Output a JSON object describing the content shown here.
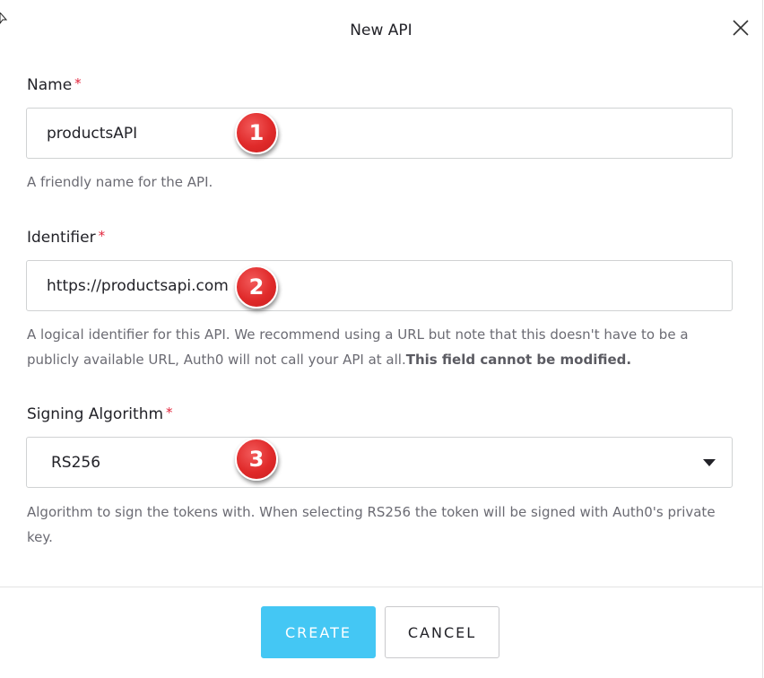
{
  "dialog": {
    "title": "New API",
    "close_icon": "close-icon"
  },
  "form": {
    "name": {
      "label": "Name",
      "required_mark": "*",
      "value": "productsAPI",
      "help": "A friendly name for the API.",
      "badge": "1"
    },
    "identifier": {
      "label": "Identifier",
      "required_mark": "*",
      "value": "https://productsapi.com",
      "help": "A logical identifier for this API. We recommend using a URL but note that this doesn't have to be a publicly available URL, Auth0 will not call your API at all.",
      "help_bold": "This field cannot be modified.",
      "badge": "2"
    },
    "signing_algorithm": {
      "label": "Signing Algorithm",
      "required_mark": "*",
      "selected": "RS256",
      "help": "Algorithm to sign the tokens with. When selecting RS256 the token will be signed with Auth0's private key.",
      "badge": "3"
    }
  },
  "actions": {
    "create_label": "CREATE",
    "cancel_label": "CANCEL"
  },
  "colors": {
    "accent": "#44c7f4",
    "required": "#e2253c",
    "badge": "#e02a2a"
  }
}
